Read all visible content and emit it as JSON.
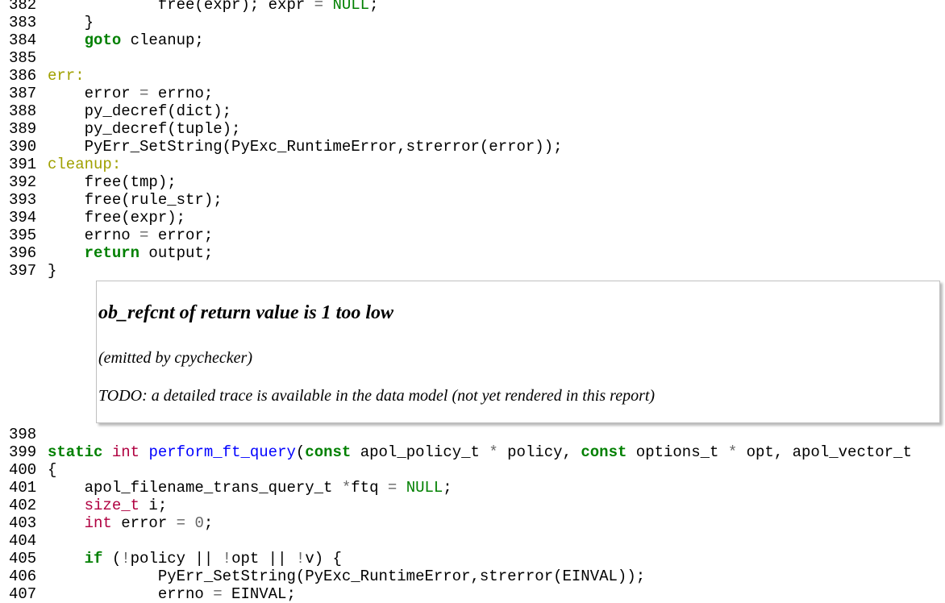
{
  "lines_top": [
    {
      "num": "382",
      "tokens": [
        [
          "",
          "            free(expr); expr "
        ],
        [
          "op",
          "="
        ],
        [
          "",
          " "
        ],
        [
          "nul",
          "NULL"
        ],
        [
          "",
          ";"
        ]
      ]
    },
    {
      "num": "383",
      "tokens": [
        [
          "",
          "    }"
        ]
      ]
    },
    {
      "num": "384",
      "tokens": [
        [
          "",
          "    "
        ],
        [
          "kw",
          "goto"
        ],
        [
          "",
          " cleanup;"
        ]
      ]
    },
    {
      "num": "385",
      "tokens": [
        [
          "",
          ""
        ]
      ]
    },
    {
      "num": "386",
      "tokens": [
        [
          "lbl",
          "err:"
        ]
      ]
    },
    {
      "num": "387",
      "tokens": [
        [
          "",
          "    error "
        ],
        [
          "op",
          "="
        ],
        [
          "",
          " errno;"
        ]
      ]
    },
    {
      "num": "388",
      "tokens": [
        [
          "",
          "    py_decref(dict);"
        ]
      ]
    },
    {
      "num": "389",
      "tokens": [
        [
          "",
          "    py_decref(tuple);"
        ]
      ]
    },
    {
      "num": "390",
      "tokens": [
        [
          "",
          "    PyErr_SetString(PyExc_RuntimeError,strerror(error));"
        ]
      ]
    },
    {
      "num": "391",
      "tokens": [
        [
          "lbl",
          "cleanup:"
        ]
      ]
    },
    {
      "num": "392",
      "tokens": [
        [
          "",
          "    free(tmp);"
        ]
      ]
    },
    {
      "num": "393",
      "tokens": [
        [
          "",
          "    free(rule_str);"
        ]
      ]
    },
    {
      "num": "394",
      "tokens": [
        [
          "",
          "    free(expr);"
        ]
      ]
    },
    {
      "num": "395",
      "tokens": [
        [
          "",
          "    errno "
        ],
        [
          "op",
          "="
        ],
        [
          "",
          " error;"
        ]
      ]
    },
    {
      "num": "396",
      "tokens": [
        [
          "",
          "    "
        ],
        [
          "kw",
          "return"
        ],
        [
          "",
          " output;"
        ]
      ]
    },
    {
      "num": "397",
      "tokens": [
        [
          "",
          "}"
        ]
      ]
    }
  ],
  "annotation": {
    "title": "ob_refcnt of return value is 1 too low",
    "emitted": "(emitted by cpychecker)",
    "todo": "TODO: a detailed trace is available in the data model (not yet rendered in this report)"
  },
  "lines_bottom": [
    {
      "num": "398",
      "tokens": [
        [
          "",
          ""
        ]
      ]
    },
    {
      "num": "399",
      "tokens": [
        [
          "kw",
          "static"
        ],
        [
          "",
          " "
        ],
        [
          "ty",
          "int"
        ],
        [
          "",
          " "
        ],
        [
          "fn",
          "perform_ft_query"
        ],
        [
          "",
          "("
        ],
        [
          "kw",
          "const"
        ],
        [
          "",
          " apol_policy_t "
        ],
        [
          "op",
          "*"
        ],
        [
          "",
          " policy, "
        ],
        [
          "kw",
          "const"
        ],
        [
          "",
          " options_t "
        ],
        [
          "op",
          "*"
        ],
        [
          "",
          " opt, apol_vector_t"
        ]
      ]
    },
    {
      "num": "400",
      "tokens": [
        [
          "",
          "{"
        ]
      ]
    },
    {
      "num": "401",
      "tokens": [
        [
          "",
          "    apol_filename_trans_query_t "
        ],
        [
          "op",
          "*"
        ],
        [
          "",
          "ftq "
        ],
        [
          "op",
          "="
        ],
        [
          "",
          " "
        ],
        [
          "nul",
          "NULL"
        ],
        [
          "",
          ";"
        ]
      ]
    },
    {
      "num": "402",
      "tokens": [
        [
          "",
          "    "
        ],
        [
          "ty",
          "size_t"
        ],
        [
          "",
          " i;"
        ]
      ]
    },
    {
      "num": "403",
      "tokens": [
        [
          "",
          "    "
        ],
        [
          "ty",
          "int"
        ],
        [
          "",
          " error "
        ],
        [
          "op",
          "="
        ],
        [
          "",
          " "
        ],
        [
          "num",
          "0"
        ],
        [
          "",
          ";"
        ]
      ]
    },
    {
      "num": "404",
      "tokens": [
        [
          "",
          ""
        ]
      ]
    },
    {
      "num": "405",
      "tokens": [
        [
          "",
          "    "
        ],
        [
          "kw",
          "if"
        ],
        [
          "",
          " ("
        ],
        [
          "op",
          "!"
        ],
        [
          "",
          "policy || "
        ],
        [
          "op",
          "!"
        ],
        [
          "",
          "opt || "
        ],
        [
          "op",
          "!"
        ],
        [
          "",
          "v) {"
        ]
      ]
    },
    {
      "num": "406",
      "tokens": [
        [
          "",
          "            PyErr_SetString(PyExc_RuntimeError,strerror(EINVAL));"
        ]
      ]
    },
    {
      "num": "407",
      "tokens": [
        [
          "",
          "            errno "
        ],
        [
          "op",
          "="
        ],
        [
          "",
          " EINVAL;"
        ]
      ]
    }
  ]
}
